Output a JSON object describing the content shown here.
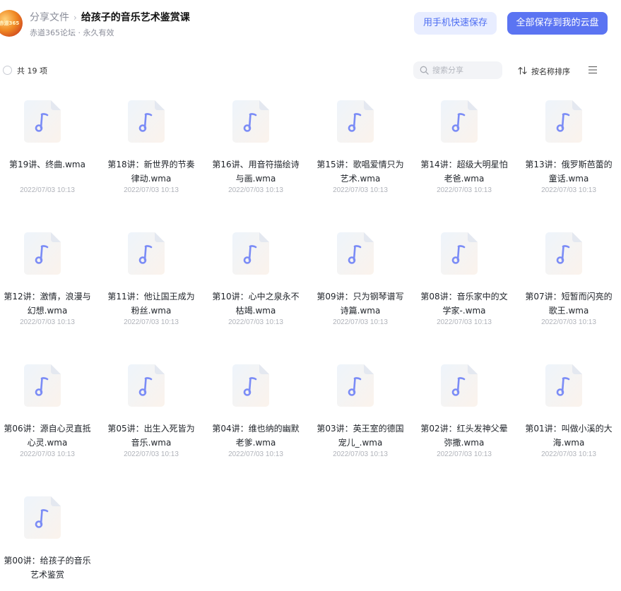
{
  "header": {
    "avatar_text": "赤道365",
    "breadcrumb_root": "分享文件",
    "separator": "›",
    "title": "给孩子的音乐艺术鉴赏课",
    "subtitle": "赤道365论坛 · 永久有效",
    "save_phone_label": "用手机快速保存",
    "save_all_label": "全部保存到我的云盘"
  },
  "toolbar": {
    "count_label": "共 19 项",
    "search_placeholder": "搜索分享",
    "sort_label": "按名称排序"
  },
  "colors": {
    "accent": "#5b74f2",
    "accent_light": "#e8edff",
    "icon_note": "#7b8cf6"
  },
  "files": [
    {
      "name": "第19讲、终曲.wma",
      "date": "2022/07/03 10:13"
    },
    {
      "name": "第18讲：新世界的节奏律动.wma",
      "date": "2022/07/03 10:13"
    },
    {
      "name": "第16讲、用音符描绘诗与画.wma",
      "date": "2022/07/03 10:13"
    },
    {
      "name": "第15讲：歌唱爱情只为艺术.wma",
      "date": "2022/07/03 10:13"
    },
    {
      "name": "第14讲：超级大明星怕老爸.wma",
      "date": "2022/07/03 10:13"
    },
    {
      "name": "第13讲：俄罗斯芭蕾的童话.wma",
      "date": "2022/07/03 10:13"
    },
    {
      "name": "第12讲：激情，浪漫与幻想.wma",
      "date": "2022/07/03 10:13"
    },
    {
      "name": "第11讲：他让国王成为粉丝.wma",
      "date": "2022/07/03 10:13"
    },
    {
      "name": "第10讲：心中之泉永不枯竭.wma",
      "date": "2022/07/03 10:13"
    },
    {
      "name": "第09讲：只为钢琴谱写诗篇.wma",
      "date": "2022/07/03 10:13"
    },
    {
      "name": "第08讲：音乐家中的文学家-.wma",
      "date": "2022/07/03 10:13"
    },
    {
      "name": "第07讲：短暂而闪亮的歌王.wma",
      "date": "2022/07/03 10:13"
    },
    {
      "name": "第06讲：源自心灵直抵心灵.wma",
      "date": "2022/07/03 10:13"
    },
    {
      "name": "第05讲：出生入死皆为音乐.wma",
      "date": "2022/07/03 10:13"
    },
    {
      "name": "第04讲：维也纳的幽默老爹.wma",
      "date": "2022/07/03 10:13"
    },
    {
      "name": "第03讲：英王室的德国宠儿_.wma",
      "date": "2022/07/03 10:13"
    },
    {
      "name": "第02讲：红头发神父晕弥撒.wma",
      "date": "2022/07/03 10:13"
    },
    {
      "name": "第01讲：叫做小溪的大海.wma",
      "date": "2022/07/03 10:13"
    },
    {
      "name": "第00讲：给孩子的音乐艺术鉴赏",
      "date": ""
    }
  ]
}
